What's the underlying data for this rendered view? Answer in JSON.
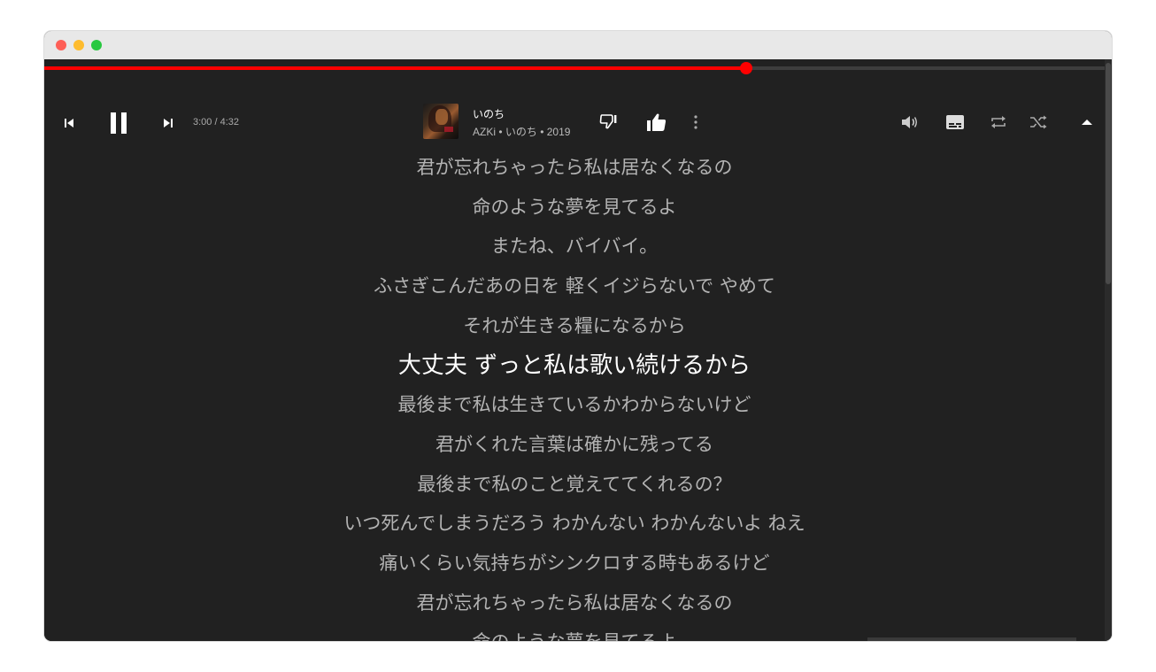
{
  "window": {
    "controls": [
      "close",
      "minimize",
      "maximize"
    ]
  },
  "colors": {
    "accent": "#ff0000",
    "background": "#212121",
    "lyric_active": "#ffffff",
    "lyric_inactive": "#b3b3b3"
  },
  "player": {
    "progress_fraction": 0.6618,
    "time_display": "3:00 / 4:32",
    "song": {
      "title": "いのち",
      "subtitle": "AZKi • いのち • 2019"
    },
    "controls": {
      "previous_icon": "skip-previous-icon",
      "pause_icon": "pause-icon",
      "next_icon": "skip-next-icon",
      "dislike_icon": "thumb-down-icon",
      "like_icon": "thumb-up-icon",
      "menu_icon": "more-vert-icon",
      "volume_icon": "volume-icon",
      "lyrics_icon": "subtitles-icon",
      "repeat_icon": "repeat-icon",
      "shuffle_icon": "shuffle-icon",
      "expand_icon": "arrow-up-icon"
    }
  },
  "lyrics": {
    "active_index": 5,
    "lines": [
      "君が忘れちゃったら私は居なくなるの",
      "命のような夢を見てるよ",
      "またね、バイバイ。",
      "ふさぎこんだあの日を 軽くイジらないで やめて",
      "それが生きる糧になるから",
      "大丈夫 ずっと私は歌い続けるから",
      "最後まで私は生きているかわからないけど",
      "君がくれた言葉は確かに残ってる",
      "最後まで私のこと覚えててくれるの？",
      "いつ死んでしまうだろう わかんない わかんないよ ねえ",
      "痛いくらい気持ちがシンクロする時もあるけど",
      "君が忘れちゃったら私は居なくなるの",
      "命のような夢を見てるよ"
    ]
  }
}
